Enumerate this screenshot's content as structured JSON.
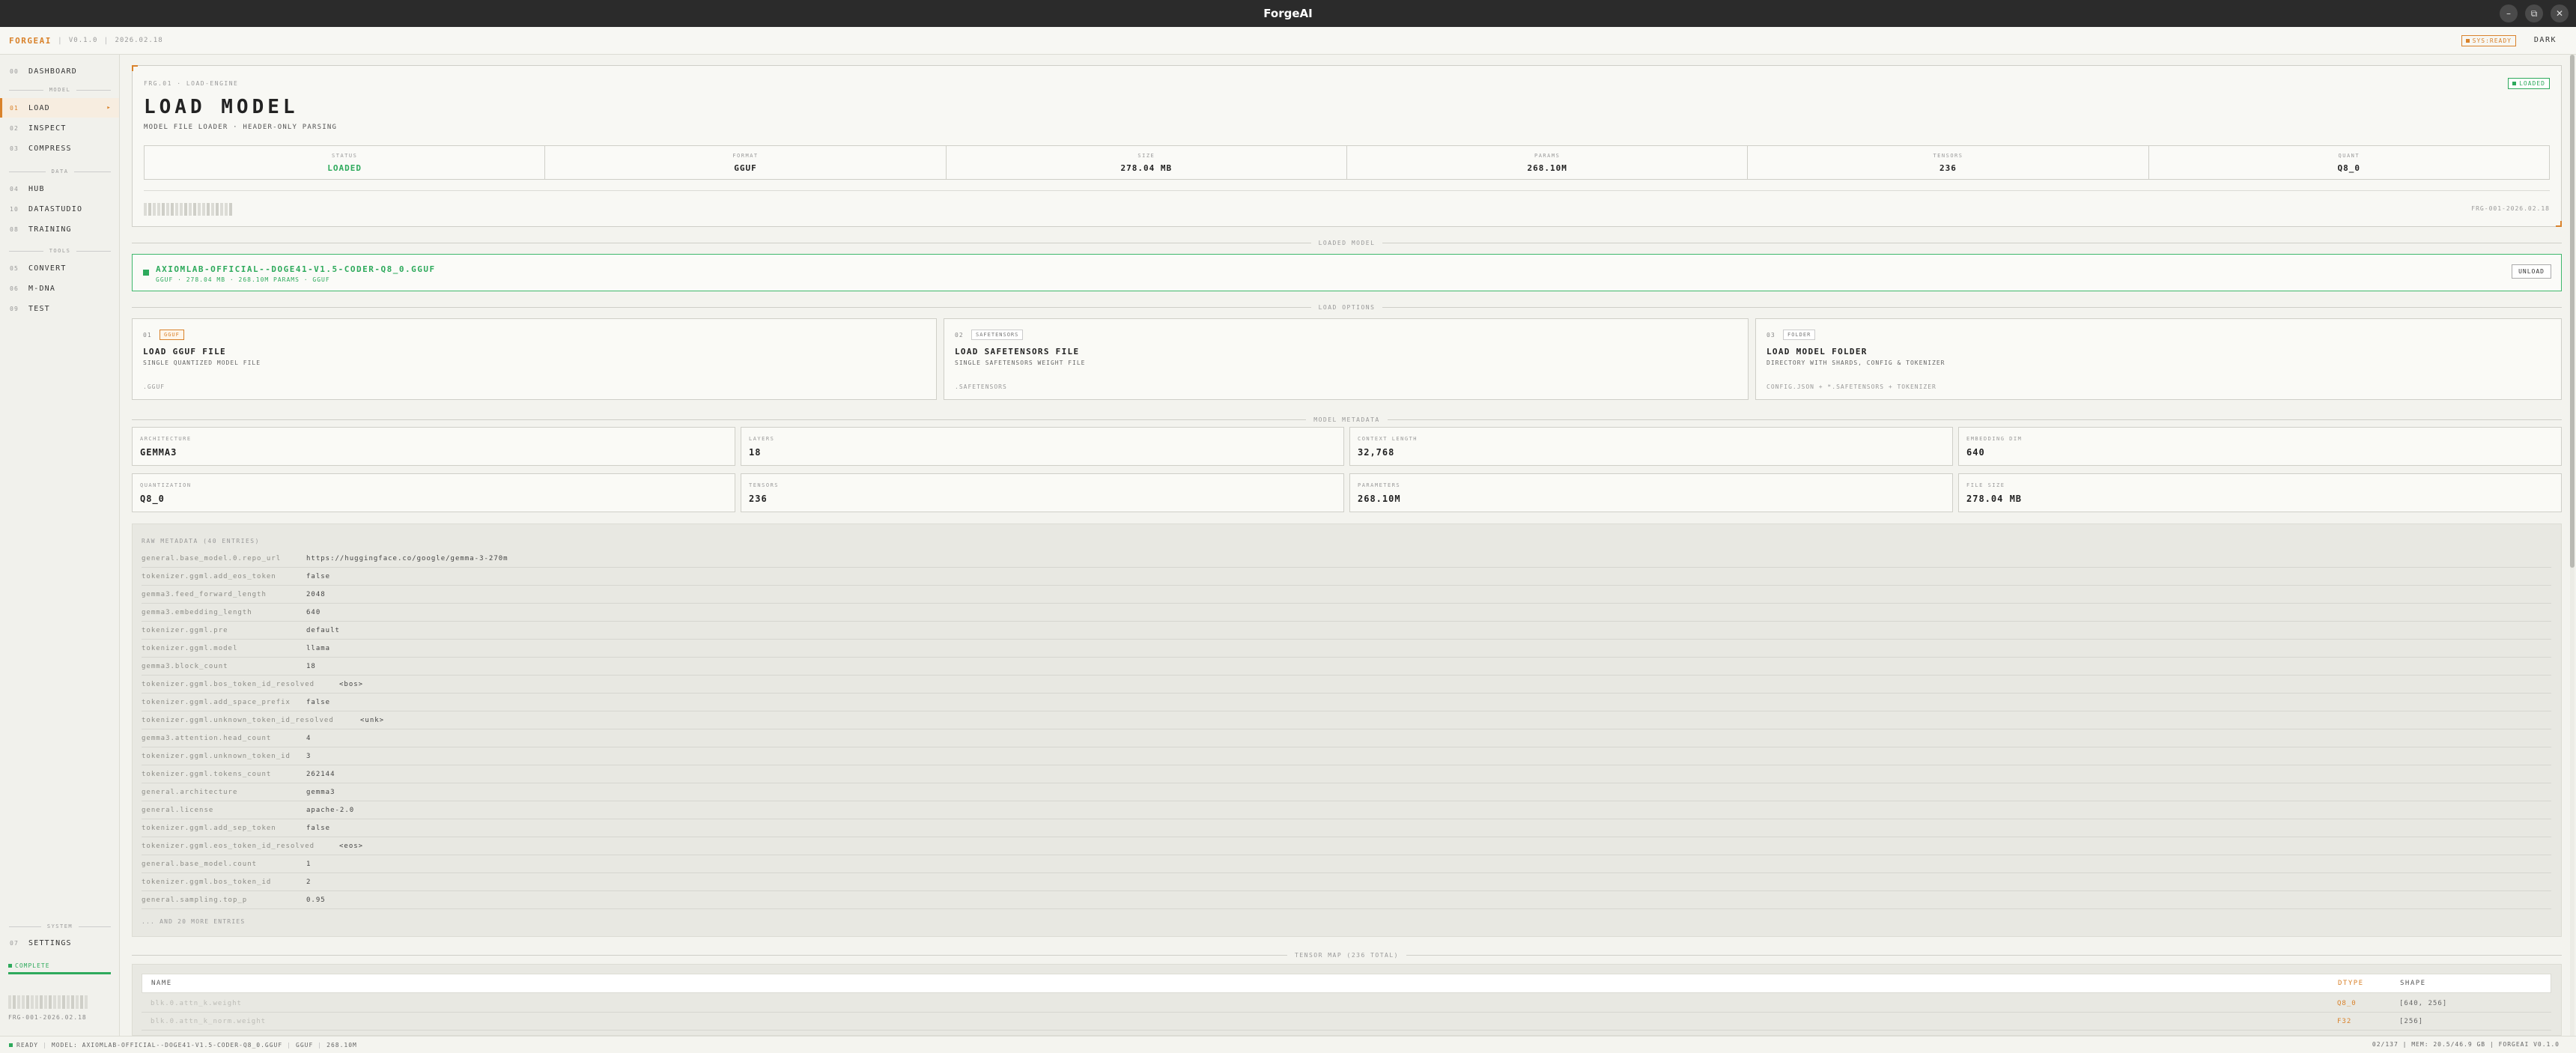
{
  "window": {
    "title": "ForgeAI",
    "controls": [
      "–",
      "⧉",
      "✕"
    ]
  },
  "header": {
    "brand": "FORGEAI",
    "version": "V0.1.0",
    "date": "2026.02.18",
    "sys_badge": "SYS:READY",
    "theme_toggle": "DARK"
  },
  "sidebar": {
    "items": [
      {
        "num": "00",
        "label": "DASHBOARD"
      },
      {
        "num": "01",
        "label": "LOAD"
      },
      {
        "num": "02",
        "label": "INSPECT"
      },
      {
        "num": "03",
        "label": "COMPRESS"
      },
      {
        "num": "04",
        "label": "HUB"
      },
      {
        "num": "10",
        "label": "DATASTUDIO"
      },
      {
        "num": "08",
        "label": "TRAINING"
      },
      {
        "num": "05",
        "label": "CONVERT"
      },
      {
        "num": "06",
        "label": "M-DNA"
      },
      {
        "num": "09",
        "label": "TEST"
      },
      {
        "num": "07",
        "label": "SETTINGS"
      }
    ],
    "groups": [
      "MODEL",
      "DATA",
      "TOOLS",
      "SYSTEM"
    ],
    "status": "COMPLETE",
    "progress": 1.0,
    "code": "FRG-001-2026.02.18"
  },
  "hero": {
    "kicker": "FRG.01 · LOAD-ENGINE",
    "title": "LOAD MODEL",
    "subtitle": "MODEL FILE LOADER · HEADER-ONLY PARSING",
    "badge": "LOADED",
    "stats": [
      {
        "label": "STATUS",
        "value": "LOADED"
      },
      {
        "label": "FORMAT",
        "value": "GGUF"
      },
      {
        "label": "SIZE",
        "value": "278.04 MB"
      },
      {
        "label": "PARAMS",
        "value": "268.10M"
      },
      {
        "label": "TENSORS",
        "value": "236"
      },
      {
        "label": "QUANT",
        "value": "Q8_0"
      }
    ],
    "code": "FRG-001-2026.02.18"
  },
  "sections": {
    "loaded": "LOADED MODEL",
    "options": "LOAD OPTIONS",
    "metadata": "MODEL METADATA",
    "tensor_map": "TENSOR MAP (236 TOTAL)"
  },
  "loaded_model": {
    "name": "AXIOMLAB-OFFICIAL--DOGE41-V1.5-CODER-Q8_0.GGUF",
    "meta": "GGUF · 278.04 MB · 268.10M PARAMS · GGUF",
    "unload": "UNLOAD"
  },
  "options": [
    {
      "num": "01",
      "tag": "GGUF",
      "title": "LOAD GGUF FILE",
      "desc": "SINGLE QUANTIZED MODEL FILE",
      "ext": ".GGUF"
    },
    {
      "num": "02",
      "tag": "SAFETENSORS",
      "title": "LOAD SAFETENSORS FILE",
      "desc": "SINGLE SAFETENSORS WEIGHT FILE",
      "ext": ".SAFETENSORS"
    },
    {
      "num": "03",
      "tag": "FOLDER",
      "title": "LOAD MODEL FOLDER",
      "desc": "DIRECTORY WITH SHARDS, CONFIG & TOKENIZER",
      "ext": "CONFIG.JSON + *.SAFETENSORS + TOKENIZER"
    }
  ],
  "metadata": [
    {
      "label": "ARCHITECTURE",
      "value": "GEMMA3"
    },
    {
      "label": "LAYERS",
      "value": "18"
    },
    {
      "label": "CONTEXT LENGTH",
      "value": "32,768"
    },
    {
      "label": "EMBEDDING DIM",
      "value": "640"
    },
    {
      "label": "QUANTIZATION",
      "value": "Q8_0"
    },
    {
      "label": "TENSORS",
      "value": "236"
    },
    {
      "label": "PARAMETERS",
      "value": "268.10M"
    },
    {
      "label": "FILE SIZE",
      "value": "278.04 MB"
    }
  ],
  "raw": {
    "header": "RAW METADATA (40 ENTRIES)",
    "rows": [
      {
        "k": "general.base_model.0.repo_url",
        "v": "https://huggingface.co/google/gemma-3-270m"
      },
      {
        "k": "tokenizer.ggml.add_eos_token",
        "v": "false"
      },
      {
        "k": "gemma3.feed_forward_length",
        "v": "2048"
      },
      {
        "k": "gemma3.embedding_length",
        "v": "640"
      },
      {
        "k": "tokenizer.ggml.pre",
        "v": "default"
      },
      {
        "k": "tokenizer.ggml.model",
        "v": "llama"
      },
      {
        "k": "gemma3.block_count",
        "v": "18"
      },
      {
        "k": "tokenizer.ggml.bos_token_id_resolved",
        "v": "<bos>"
      },
      {
        "k": "tokenizer.ggml.add_space_prefix",
        "v": "false"
      },
      {
        "k": "tokenizer.ggml.unknown_token_id_resolved",
        "v": "<unk>"
      },
      {
        "k": "gemma3.attention.head_count",
        "v": "4"
      },
      {
        "k": "tokenizer.ggml.unknown_token_id",
        "v": "3"
      },
      {
        "k": "tokenizer.ggml.tokens_count",
        "v": "262144"
      },
      {
        "k": "general.architecture",
        "v": "gemma3"
      },
      {
        "k": "general.license",
        "v": "apache-2.0"
      },
      {
        "k": "tokenizer.ggml.add_sep_token",
        "v": "false"
      },
      {
        "k": "tokenizer.ggml.eos_token_id_resolved",
        "v": "<eos>"
      },
      {
        "k": "general.base_model.count",
        "v": "1"
      },
      {
        "k": "tokenizer.ggml.bos_token_id",
        "v": "2"
      },
      {
        "k": "general.sampling.top_p",
        "v": "0.95"
      }
    ],
    "more": "... AND 20 MORE ENTRIES"
  },
  "tensor_table": {
    "columns": [
      "NAME",
      "DTYPE",
      "SHAPE"
    ],
    "rows": [
      {
        "name": "blk.0.attn_k.weight",
        "dtype": "Q8_0",
        "shape": "[640, 256]"
      },
      {
        "name": "blk.0.attn_k_norm.weight",
        "dtype": "F32",
        "shape": "[256]"
      }
    ]
  },
  "statusbar": {
    "ready": "READY",
    "model": "MODEL: AXIOMLAB-OFFICIAL--DOGE41-V1.5-CODER-Q8_0.GGUF",
    "format": "GGUF",
    "params": "268.10M",
    "right": "02/137 | MEM: 20.5/46.9 GB | FORGEAI V0.1.0"
  },
  "colors": {
    "accent": "#d9822b",
    "success": "#2eaa5c",
    "titlebar": "#2b2b2b",
    "background": "#f3f3ee"
  },
  "icons": {
    "status_dot": "square-dot-icon",
    "active_arrow": "arrow-right-icon"
  }
}
